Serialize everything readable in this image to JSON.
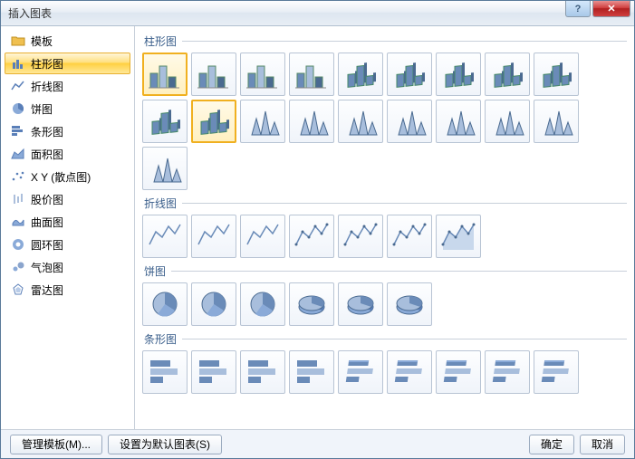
{
  "window": {
    "title": "插入图表"
  },
  "sidebar": {
    "items": [
      {
        "label": "模板",
        "icon": "folder-icon"
      },
      {
        "label": "柱形图",
        "icon": "column-chart-icon"
      },
      {
        "label": "折线图",
        "icon": "line-chart-icon"
      },
      {
        "label": "饼图",
        "icon": "pie-chart-icon"
      },
      {
        "label": "条形图",
        "icon": "bar-chart-icon"
      },
      {
        "label": "面积图",
        "icon": "area-chart-icon"
      },
      {
        "label": "X Y (散点图)",
        "icon": "scatter-chart-icon"
      },
      {
        "label": "股价图",
        "icon": "stock-chart-icon"
      },
      {
        "label": "曲面图",
        "icon": "surface-chart-icon"
      },
      {
        "label": "圆环图",
        "icon": "doughnut-chart-icon"
      },
      {
        "label": "气泡图",
        "icon": "bubble-chart-icon"
      },
      {
        "label": "雷达图",
        "icon": "radar-chart-icon"
      }
    ],
    "selected_index": 1
  },
  "sections": {
    "column": {
      "label": "柱形图",
      "count": 19,
      "selected": [
        0,
        10
      ]
    },
    "line": {
      "label": "折线图",
      "count": 7,
      "selected": []
    },
    "pie": {
      "label": "饼图",
      "count": 6,
      "selected": []
    },
    "bar": {
      "label": "条形图",
      "count": 9,
      "selected": []
    }
  },
  "footer": {
    "manage_templates": "管理模板(M)...",
    "set_default": "设置为默认图表(S)",
    "ok": "确定",
    "cancel": "取消"
  },
  "colors": {
    "accent": "#ffd24a",
    "tile_border": "#b8c4d4",
    "blue": "#6a8bb8"
  }
}
